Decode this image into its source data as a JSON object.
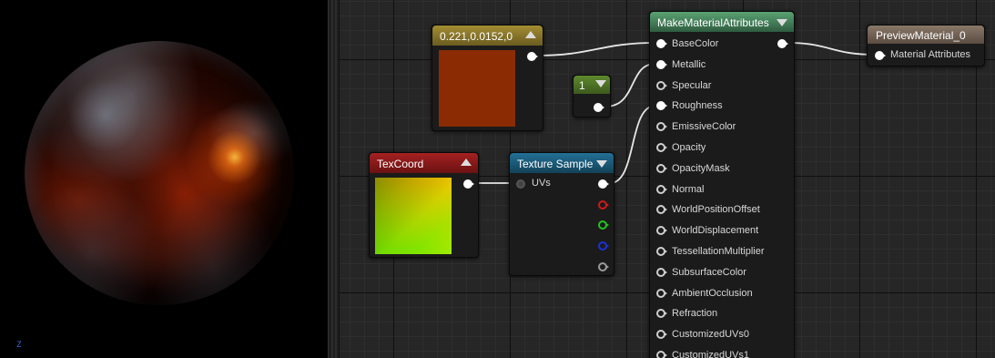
{
  "viewport": {
    "axis_label": "Z"
  },
  "nodes": {
    "color_constant": {
      "title": "0.221,0.0152,0",
      "swatch": "#8a2b04"
    },
    "scalar_constant": {
      "title": "1"
    },
    "texcoord": {
      "title": "TexCoord"
    },
    "texture_sample": {
      "title": "Texture Sample",
      "input_label": "UVs"
    },
    "make_attributes": {
      "title": "MakeMaterialAttributes",
      "inputs": [
        "BaseColor",
        "Metallic",
        "Specular",
        "Roughness",
        "EmissiveColor",
        "Opacity",
        "OpacityMask",
        "Normal",
        "WorldPositionOffset",
        "WorldDisplacement",
        "TessellationMultiplier",
        "SubsurfaceColor",
        "AmbientOcclusion",
        "Refraction",
        "CustomizedUVs0",
        "CustomizedUVs1"
      ]
    },
    "preview_material": {
      "title": "PreviewMaterial_0",
      "input_label": "Material Attributes"
    }
  },
  "colors": {
    "constant_header": "#8c7a2a",
    "scalar_header": "#4d6f27",
    "texcoord_header": "#8e1c1c",
    "texture_header": "#1c5a78",
    "make_attr_header": "#4b8a62",
    "preview_header": "#7a6a5e",
    "pin_red": "#d01a1a",
    "pin_green": "#22c41e",
    "pin_blue": "#1a30d8"
  }
}
